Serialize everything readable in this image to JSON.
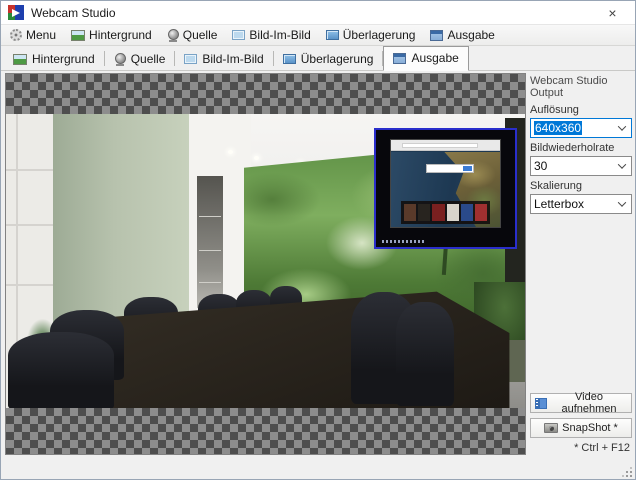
{
  "window": {
    "title": "Webcam Studio",
    "close_glyph": "×"
  },
  "menubar": {
    "items": [
      {
        "label": "Menu",
        "icon": "gear-icon"
      },
      {
        "label": "Hintergrund",
        "icon": "background-image-icon"
      },
      {
        "label": "Quelle",
        "icon": "webcam-icon"
      },
      {
        "label": "Bild-Im-Bild",
        "icon": "picture-in-picture-icon"
      },
      {
        "label": "Überlagerung",
        "icon": "overlay-monitor-icon"
      },
      {
        "label": "Ausgabe",
        "icon": "output-window-icon"
      }
    ]
  },
  "tabs": [
    {
      "label": "Hintergrund",
      "active": false
    },
    {
      "label": "Quelle",
      "active": false
    },
    {
      "label": "Bild-Im-Bild",
      "active": false
    },
    {
      "label": "Überlagerung",
      "active": false
    },
    {
      "label": "Ausgabe",
      "active": true
    }
  ],
  "preview": {
    "description": "conference room photo with forest-stream mural, letterbox transparency checkerboard, browser picture-in-picture overlay at top right",
    "pip_border_color": "#2a2ecb"
  },
  "output_panel": {
    "title": "Webcam Studio Output",
    "fields": [
      {
        "label": "Auflösung",
        "value": "640x360",
        "focused": true
      },
      {
        "label": "Bildwiederholrate",
        "value": "30",
        "focused": false
      },
      {
        "label": "Skalierung",
        "value": "Letterbox",
        "focused": false
      }
    ],
    "record_button": "Video aufnehmen",
    "snapshot_button": "SnapShot  *",
    "hotkey_note": "* Ctrl + F12"
  },
  "colors": {
    "selection": "#0078d7",
    "checker_dark": "#4e4e4e",
    "checker_light": "#8d8d8d"
  }
}
